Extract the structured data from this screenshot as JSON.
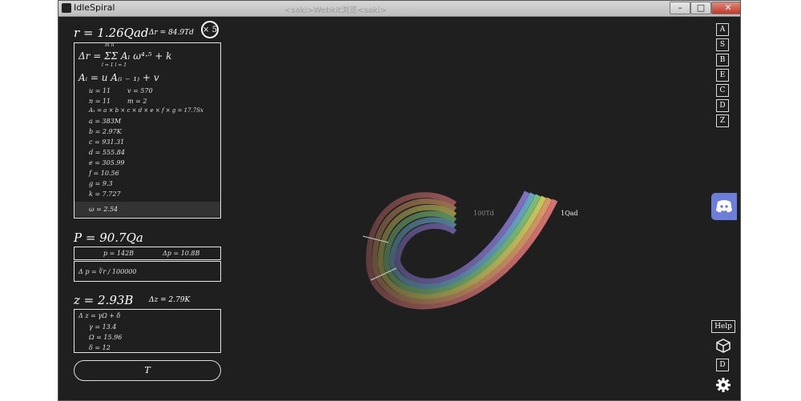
{
  "window": {
    "title": "IdleSpiral",
    "background_title": "<saki>Webkit浏览<saki>",
    "buttons": {
      "minimize": "–",
      "maximize": "□",
      "close": "✕"
    }
  },
  "colors": {
    "background": "#1f1f1f",
    "accent": "#6c7ed8",
    "text": "#ffffff"
  },
  "radius": {
    "value": "r = 1.26Qad",
    "delta": "Δr = 84.9Td",
    "multiplier": "× 5",
    "formula1": "Δr = ΣΣ Aₗ ω⁴·⁵ + k",
    "sum_top": "m  n",
    "sum_bottom": "l = 1  l = 1",
    "formula2": "Aᵢ = u A₍ᵢ ₋ ₁₎ + v",
    "vars_row1": [
      "u = 11",
      "v = 570"
    ],
    "vars_row2": [
      "n = 11",
      "m = 2"
    ],
    "product": "A₁ = a × b × c × d × e × f × g = 17.7Sx",
    "params": [
      "a = 383M",
      "b = 2.97K",
      "c = 931.31",
      "d = 555.84",
      "e = 305.99",
      "f = 10.56",
      "g = 9.3",
      "k = 7.727"
    ],
    "omega": "ω = 2.54"
  },
  "power": {
    "value": "P = 90.7Qa",
    "p": "p = 142B",
    "delta_p": "Δp = 10.8B",
    "formula": "Δ p = ∛r / 100000"
  },
  "z": {
    "value": "z = 2.93B",
    "delta": "Δz = 2.79K",
    "formula": "Δ z = γΩ + δ",
    "params": [
      "γ = 13.4",
      "Ω = 15.96",
      "δ = 12"
    ]
  },
  "t_button": "T",
  "right_buttons": [
    "A",
    "S",
    "B",
    "E",
    "C",
    "D",
    "Z"
  ],
  "help_label": "Help",
  "bottom_d": "D",
  "spiral_labels": {
    "inner": "100Td",
    "outer": "1Qad"
  },
  "icons": [
    "discord-icon",
    "cube-icon",
    "gear-icon"
  ]
}
